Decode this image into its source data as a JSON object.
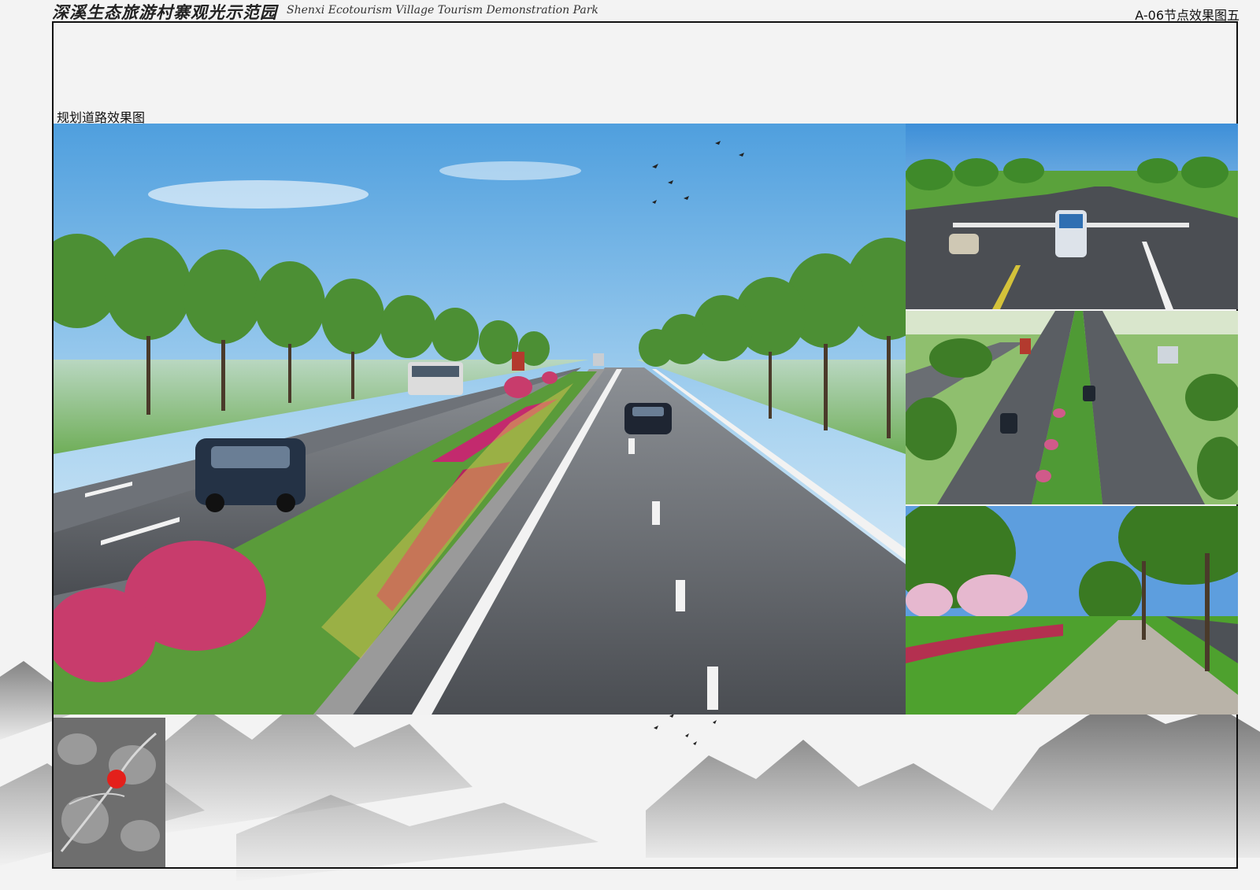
{
  "header": {
    "title_cn": "深溪生态旅游村寨观光示范园",
    "title_en": "Shenxi Ecotourism Village Tourism Demonstration Park",
    "page_code": "A-06节点效果图五"
  },
  "section": {
    "label": "规划道路效果图"
  },
  "images": {
    "main": "road-rendering-main",
    "thumb_1": "intersection-rendering",
    "thumb_2": "boulevard-aerial-rendering",
    "thumb_3": "sidewalk-rendering",
    "locator": "site-locator-map"
  },
  "colors": {
    "frame": "#111111",
    "marker": "#e3201b"
  }
}
